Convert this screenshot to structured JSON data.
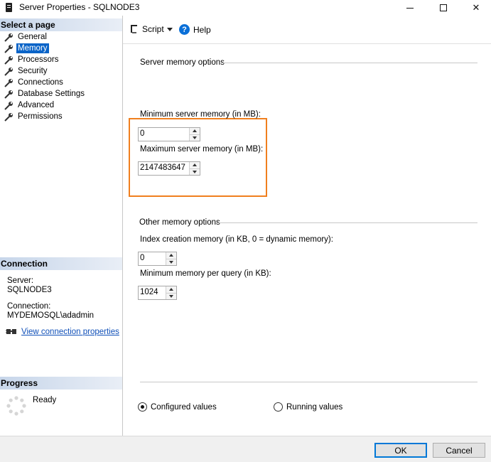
{
  "window": {
    "title": "Server Properties - SQLNODE3"
  },
  "sidebar": {
    "select_page_header": "Select a page",
    "pages": [
      {
        "label": "General"
      },
      {
        "label": "Memory"
      },
      {
        "label": "Processors"
      },
      {
        "label": "Security"
      },
      {
        "label": "Connections"
      },
      {
        "label": "Database Settings"
      },
      {
        "label": "Advanced"
      },
      {
        "label": "Permissions"
      }
    ],
    "selected_page": "Memory",
    "connection": {
      "header": "Connection",
      "server_label": "Server:",
      "server_value": "SQLNODE3",
      "connection_label": "Connection:",
      "connection_value": "MYDEMOSQL\\adadmin",
      "link_text": "View connection properties"
    },
    "progress": {
      "header": "Progress",
      "status": "Ready"
    }
  },
  "toolbar": {
    "script_label": "Script",
    "help_label": "Help"
  },
  "server_memory": {
    "group_title": "Server memory options",
    "min_label": "Minimum server memory (in MB):",
    "min_value": "0",
    "max_label": "Maximum server memory (in MB):",
    "max_value": "2147483647"
  },
  "other_memory": {
    "group_title": "Other memory options",
    "index_label": "Index creation memory (in KB, 0 = dynamic memory):",
    "index_value": "0",
    "query_label": "Minimum memory per query (in KB):",
    "query_value": "1024"
  },
  "view_options": {
    "configured_label": "Configured values",
    "running_label": "Running values",
    "selected": "configured"
  },
  "footer": {
    "ok_label": "OK",
    "cancel_label": "Cancel"
  },
  "colors": {
    "highlight": "#f07f1e",
    "selection": "#0a64c8",
    "link": "#0f4fb8"
  }
}
